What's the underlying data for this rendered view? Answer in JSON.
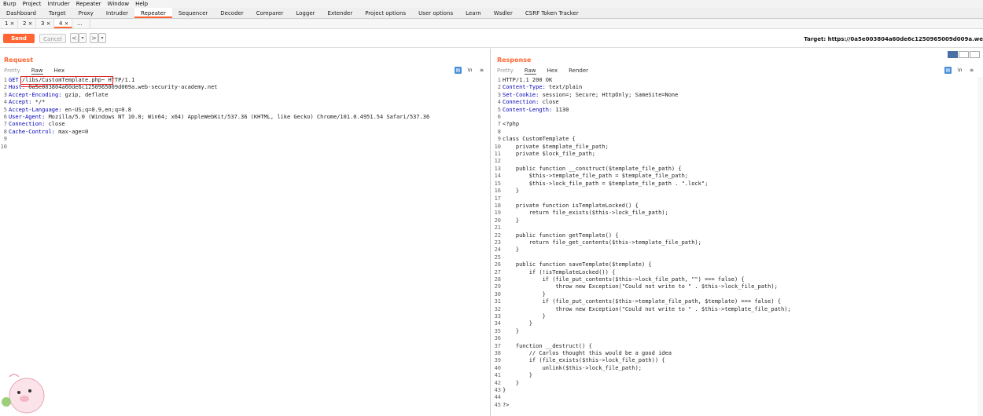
{
  "menu": [
    "Burp",
    "Project",
    "Intruder",
    "Repeater",
    "Window",
    "Help"
  ],
  "main_tabs": [
    "Dashboard",
    "Target",
    "Proxy",
    "Intruder",
    "Repeater",
    "Sequencer",
    "Decoder",
    "Comparer",
    "Logger",
    "Extender",
    "Project options",
    "User options",
    "Learn",
    "Wsdler",
    "CSRF Token Tracker"
  ],
  "active_main_tab": "Repeater",
  "repeater_tabs": [
    "1 ×",
    "2 ×",
    "3 ×",
    "4 ×",
    "..."
  ],
  "toolbar": {
    "send": "Send",
    "cancel": "Cancel",
    "back": "<",
    "back_drop": "▾",
    "fwd": ">",
    "fwd_drop": "▾",
    "target": "Target: https://0a5e003804a60de6c1250965009d009a.we"
  },
  "request": {
    "title": "Request",
    "tabs": [
      "Pretty",
      "Raw",
      "Hex"
    ],
    "lines": [
      {
        "k": "GET",
        "v": " /libs/CustomTemplate.php~ HTTP/1.1"
      },
      {
        "k": "Host:",
        "v": " 0a5e003804a60de6c1250965009d009a.web-security-academy.net"
      },
      {
        "k": "Accept-Encoding:",
        "v": " gzip, deflate"
      },
      {
        "k": "Accept:",
        "v": " */*"
      },
      {
        "k": "Accept-Language:",
        "v": " en-US;q=0.9,en;q=0.8"
      },
      {
        "k": "User-Agent:",
        "v": " Mozilla/5.0 (Windows NT 10.0; Win64; x64) AppleWebKit/537.36 (KHTML, like Gecko) Chrome/101.0.4951.54 Safari/537.36"
      },
      {
        "k": "Connection:",
        "v": " close"
      },
      {
        "k": "Cache-Control:",
        "v": " max-age=0"
      },
      {
        "k": "",
        "v": ""
      },
      {
        "k": "",
        "v": ""
      }
    ]
  },
  "response": {
    "title": "Response",
    "tabs": [
      "Pretty",
      "Raw",
      "Hex",
      "Render"
    ],
    "lines": [
      {
        "k": "",
        "v": "HTTP/1.1 200 OK"
      },
      {
        "k": "Content-Type:",
        "v": " text/plain"
      },
      {
        "k": "Set-Cookie:",
        "v": " session=; Secure; HttpOnly; SameSite=None"
      },
      {
        "k": "Connection:",
        "v": " close"
      },
      {
        "k": "Content-Length:",
        "v": " 1130"
      },
      {
        "k": "",
        "v": ""
      },
      {
        "k": "",
        "v": "<?php"
      },
      {
        "k": "",
        "v": ""
      },
      {
        "k": "",
        "v": "class CustomTemplate {"
      },
      {
        "k": "",
        "v": "    private $template_file_path;"
      },
      {
        "k": "",
        "v": "    private $lock_file_path;"
      },
      {
        "k": "",
        "v": ""
      },
      {
        "k": "",
        "v": "    public function __construct($template_file_path) {"
      },
      {
        "k": "",
        "v": "        $this->template_file_path = $template_file_path;"
      },
      {
        "k": "",
        "v": "        $this->lock_file_path = $template_file_path . \".lock\";"
      },
      {
        "k": "",
        "v": "    }"
      },
      {
        "k": "",
        "v": ""
      },
      {
        "k": "",
        "v": "    private function isTemplateLocked() {"
      },
      {
        "k": "",
        "v": "        return file_exists($this->lock_file_path);"
      },
      {
        "k": "",
        "v": "    }"
      },
      {
        "k": "",
        "v": ""
      },
      {
        "k": "",
        "v": "    public function getTemplate() {"
      },
      {
        "k": "",
        "v": "        return file_get_contents($this->template_file_path);"
      },
      {
        "k": "",
        "v": "    }"
      },
      {
        "k": "",
        "v": ""
      },
      {
        "k": "",
        "v": "    public function saveTemplate($template) {"
      },
      {
        "k": "",
        "v": "        if (!isTemplateLocked()) {"
      },
      {
        "k": "",
        "v": "            if (file_put_contents($this->lock_file_path, \"\") === false) {"
      },
      {
        "k": "",
        "v": "                throw new Exception(\"Could not write to \" . $this->lock_file_path);"
      },
      {
        "k": "",
        "v": "            }"
      },
      {
        "k": "",
        "v": "            if (file_put_contents($this->template_file_path, $template) === false) {"
      },
      {
        "k": "",
        "v": "                throw new Exception(\"Could not write to \" . $this->template_file_path);"
      },
      {
        "k": "",
        "v": "            }"
      },
      {
        "k": "",
        "v": "        }"
      },
      {
        "k": "",
        "v": "    }"
      },
      {
        "k": "",
        "v": ""
      },
      {
        "k": "",
        "v": "    function __destruct() {"
      },
      {
        "k": "",
        "v": "        // Carlos thought this would be a good idea"
      },
      {
        "k": "",
        "v": "        if (file_exists($this->lock_file_path)) {"
      },
      {
        "k": "",
        "v": "            unlink($this->lock_file_path);"
      },
      {
        "k": "",
        "v": "        }"
      },
      {
        "k": "",
        "v": "    }"
      },
      {
        "k": "",
        "v": "}"
      },
      {
        "k": "",
        "v": ""
      },
      {
        "k": "",
        "v": "?>"
      }
    ]
  },
  "colors": {
    "accent": "#ff6633",
    "header_key": "#0000b8",
    "highlight": "#e02020"
  }
}
